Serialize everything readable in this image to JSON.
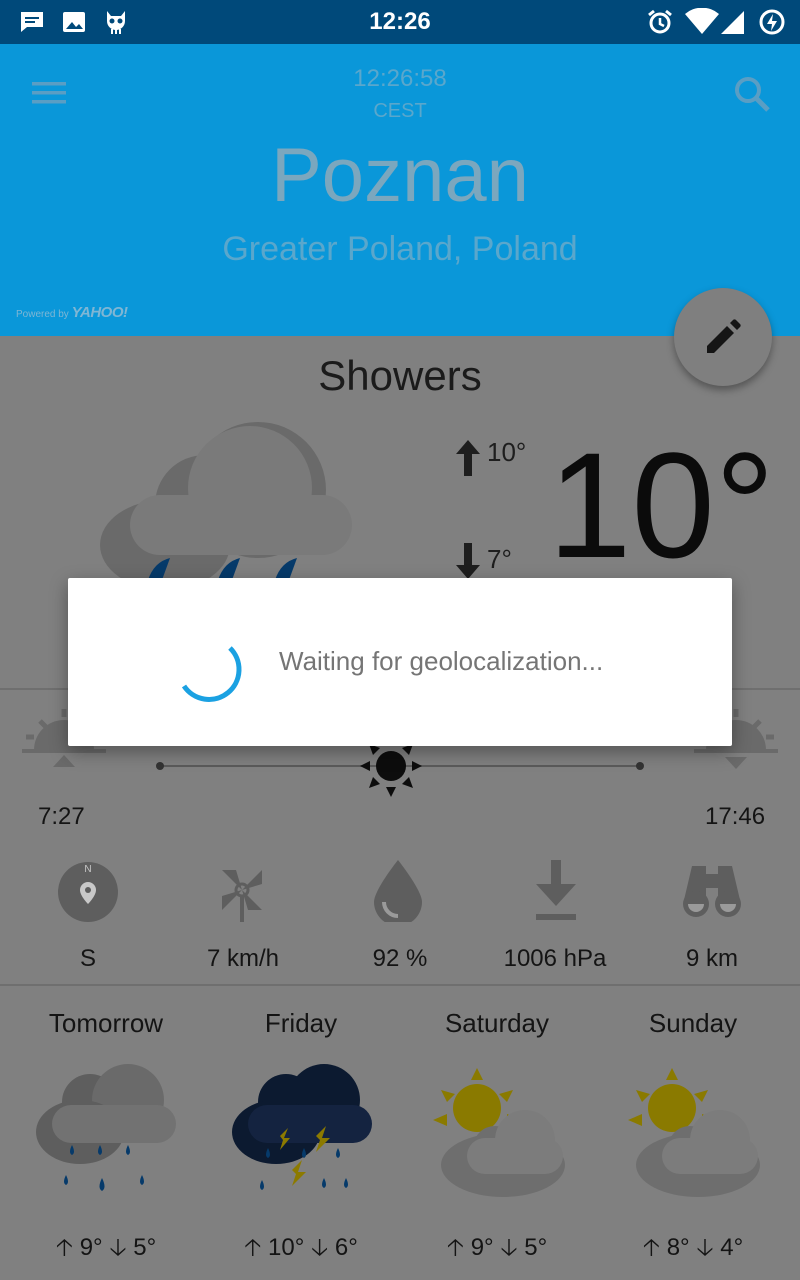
{
  "status_bar": {
    "time": "12:26",
    "left_icons": [
      "message-icon",
      "image-icon",
      "cyanogen-icon"
    ],
    "right_icons": [
      "alarm-icon",
      "wifi-icon",
      "signal-icon",
      "battery-charging-icon"
    ]
  },
  "header": {
    "clock": "12:26:58",
    "timezone": "CEST",
    "city": "Poznan",
    "region": "Greater Poland, Poland",
    "powered_by_prefix": "Powered by",
    "powered_by_brand": "YAHOO!",
    "background_color": "#0a97d9"
  },
  "current": {
    "condition": "Showers",
    "temperature": "10°",
    "high": "10°",
    "low": "7°"
  },
  "sun": {
    "sunrise": "7:27",
    "sunset": "17:46"
  },
  "details": [
    {
      "icon": "compass-icon",
      "value": "S"
    },
    {
      "icon": "windmill-icon",
      "value": "7 km/h"
    },
    {
      "icon": "humidity-drop-icon",
      "value": "92 %"
    },
    {
      "icon": "pressure-icon",
      "value": "1006 hPa"
    },
    {
      "icon": "binoculars-icon",
      "value": "9 km"
    }
  ],
  "forecast": [
    {
      "day": "Tomorrow",
      "icon": "rain-cloud-icon",
      "high": "9°",
      "low": "5°"
    },
    {
      "day": "Friday",
      "icon": "thunderstorm-icon",
      "high": "10°",
      "low": "6°"
    },
    {
      "day": "Saturday",
      "icon": "partly-cloudy-icon",
      "high": "9°",
      "low": "5°"
    },
    {
      "day": "Sunday",
      "icon": "partly-cloudy-icon",
      "high": "8°",
      "low": "4°"
    }
  ],
  "dialog": {
    "message": "Waiting for geolocalization...",
    "spinner_color": "#1ba1e2"
  }
}
